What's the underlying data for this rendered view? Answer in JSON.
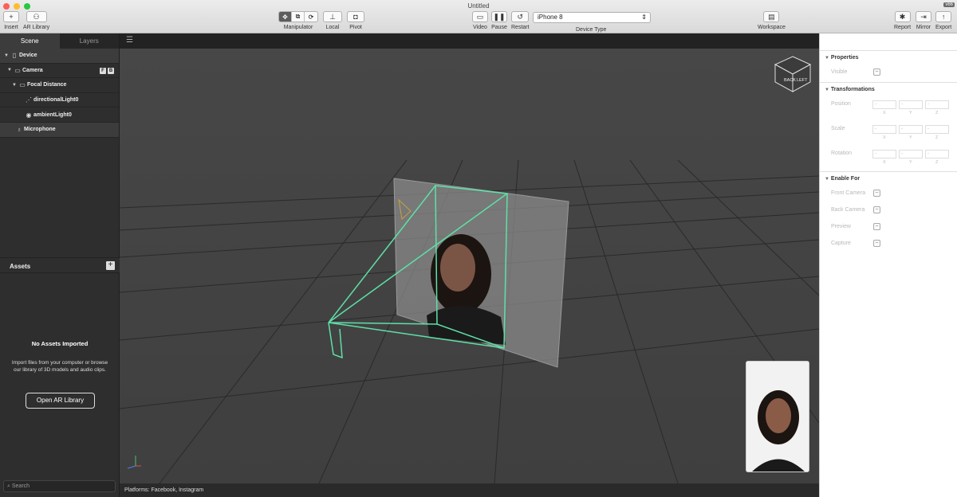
{
  "window": {
    "title": "Untitled",
    "version": "v66",
    "colors": {
      "red": "#fe5f57",
      "yellow": "#febc2e",
      "green": "#28c840"
    }
  },
  "toolbar": {
    "insert": "Insert",
    "ar_library": "AR Library",
    "manipulator": "Manipulator",
    "local": "Local",
    "pivot": "Pivot",
    "video": "Video",
    "pause": "Pause",
    "restart": "Restart",
    "device_type": "Device Type",
    "device_value": "iPhone 8",
    "workspace": "Workspace",
    "report": "Report",
    "mirror": "Mirror",
    "export": "Export"
  },
  "left": {
    "tabs": [
      "Scene",
      "Layers"
    ],
    "tree": [
      {
        "label": "Device",
        "icon": "phone-icon"
      },
      {
        "label": "Camera",
        "icon": "camera-icon",
        "badges": [
          "F",
          "B"
        ]
      },
      {
        "label": "Focal Distance",
        "icon": "focal-distance-icon"
      },
      {
        "label": "directionalLight0",
        "icon": "directional-light-icon"
      },
      {
        "label": "ambientLight0",
        "icon": "ambient-light-icon"
      },
      {
        "label": "Microphone",
        "icon": "microphone-icon"
      }
    ],
    "assets_title": "Assets",
    "no_assets": "No Assets Imported",
    "assets_desc": "Import files from your computer or browse our library of 3D models and audio clips.",
    "open_lib": "Open AR Library",
    "search_placeholder": "Search"
  },
  "viewport": {
    "cube_labels": [
      "BACK",
      "LEFT"
    ],
    "status": "Platforms: Facebook, Instagram"
  },
  "right": {
    "properties": "Properties",
    "visible": "Visible",
    "transformations": "Transformations",
    "position": "Position",
    "scale": "Scale",
    "rotation": "Rotation",
    "axes": [
      "X",
      "Y",
      "Z"
    ],
    "placeholder": "-",
    "enable_for": "Enable For",
    "front_camera": "Front Camera",
    "back_camera": "Back Camera",
    "preview": "Preview",
    "capture": "Capture"
  }
}
